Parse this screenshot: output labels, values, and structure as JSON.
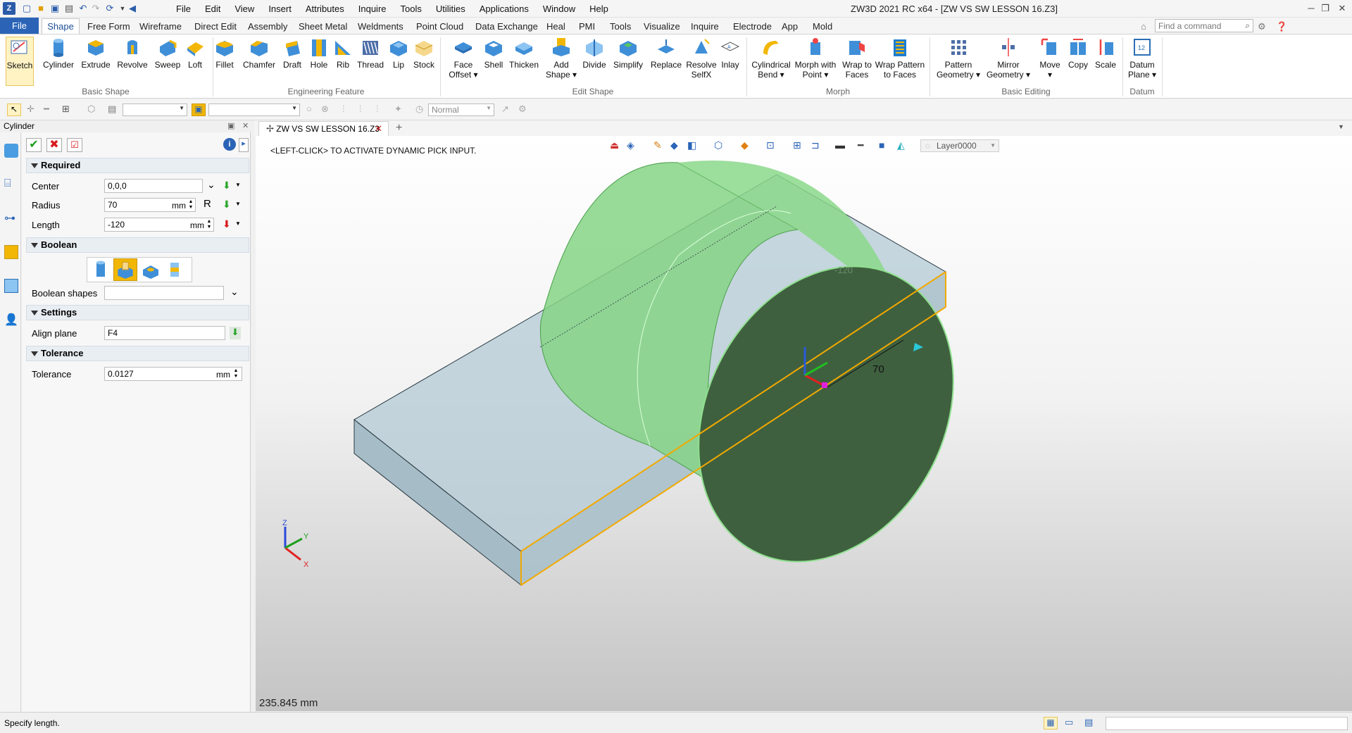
{
  "window": {
    "title": "ZW3D 2021 RC x64 - [ZW VS SW LESSON 16.Z3]",
    "menu": [
      "File",
      "Edit",
      "View",
      "Insert",
      "Attributes",
      "Inquire",
      "Tools",
      "Utilities",
      "Applications",
      "Window",
      "Help"
    ]
  },
  "ribbon_tabs": [
    "File",
    "Shape",
    "Free Form",
    "Wireframe",
    "Direct Edit",
    "Assembly",
    "Sheet Metal",
    "Weldments",
    "Point Cloud",
    "Data Exchange",
    "Heal",
    "PMI",
    "Tools",
    "Visualize",
    "Inquire",
    "Electrode",
    "App",
    "Mold"
  ],
  "command_search": {
    "placeholder": "Find a command"
  },
  "ribbon": {
    "groups": {
      "basic_shape": "Basic Shape",
      "engineering_feature": "Engineering Feature",
      "edit_shape": "Edit Shape",
      "morph": "Morph",
      "basic_editing": "Basic Editing",
      "datum": "Datum"
    },
    "buttons": {
      "sketch": "Sketch",
      "cylinder": "Cylinder",
      "extrude": "Extrude",
      "revolve": "Revolve",
      "sweep": "Sweep",
      "loft": "Loft",
      "fillet": "Fillet",
      "chamfer": "Chamfer",
      "draft": "Draft",
      "hole": "Hole",
      "rib": "Rib",
      "thread": "Thread",
      "lip": "Lip",
      "stock": "Stock",
      "face_offset_1": "Face",
      "face_offset_2": "Offset",
      "shell": "Shell",
      "thicken": "Thicken",
      "add_shape_1": "Add",
      "add_shape_2": "Shape",
      "divide": "Divide",
      "simplify": "Simplify",
      "replace": "Replace",
      "resolve_1": "Resolve",
      "resolve_2": "SelfX",
      "inlay": "Inlay",
      "cyl_bend_1": "Cylindrical",
      "cyl_bend_2": "Bend",
      "morph_point_1": "Morph with",
      "morph_point_2": "Point",
      "wrap_faces_1": "Wrap to",
      "wrap_faces_2": "Faces",
      "wrap_pattern_1": "Wrap Pattern",
      "wrap_pattern_2": "to Faces",
      "pattern_1": "Pattern",
      "pattern_2": "Geometry",
      "mirror_1": "Mirror",
      "mirror_2": "Geometry",
      "move": "Move",
      "copy": "Copy",
      "scale": "Scale",
      "datum_1": "Datum",
      "datum_2": "Plane"
    }
  },
  "toolbar": {
    "filter_value": "Normal"
  },
  "panel": {
    "title": "Cylinder",
    "sections": {
      "required": "Required",
      "boolean": "Boolean",
      "settings": "Settings",
      "tolerance": "Tolerance"
    },
    "fields": {
      "center_label": "Center",
      "center_value": "0,0,0",
      "radius_label": "Radius",
      "radius_value": "70",
      "radius_unit": "mm",
      "radius_flag": "R",
      "length_label": "Length",
      "length_value": "-120",
      "length_unit": "mm",
      "boolean_shapes_label": "Boolean shapes",
      "boolean_shapes_value": "",
      "align_plane_label": "Align plane",
      "align_plane_value": "F4",
      "tolerance_label": "Tolerance",
      "tolerance_value": "0.0127",
      "tolerance_unit": "mm"
    }
  },
  "document": {
    "tab_title": "ZW VS SW LESSON 16.Z3"
  },
  "viewport": {
    "prompt": "<LEFT-CLICK> TO ACTIVATE DYNAMIC PICK INPUT.",
    "layer": "Layer0000",
    "radius_dim": "70",
    "length_dim": "-120",
    "measure": "235.845 mm",
    "axis_x": "X",
    "axis_y": "Y",
    "axis_z": "Z"
  },
  "statusbar": {
    "text": "Specify length."
  },
  "colors": {
    "accent": "#2b64b7",
    "cylinder_fill": "#7fd07f",
    "cylinder_end": "#3e5f3e",
    "box_fill": "#a9c3cf",
    "highlight_edge": "#f2a900"
  }
}
